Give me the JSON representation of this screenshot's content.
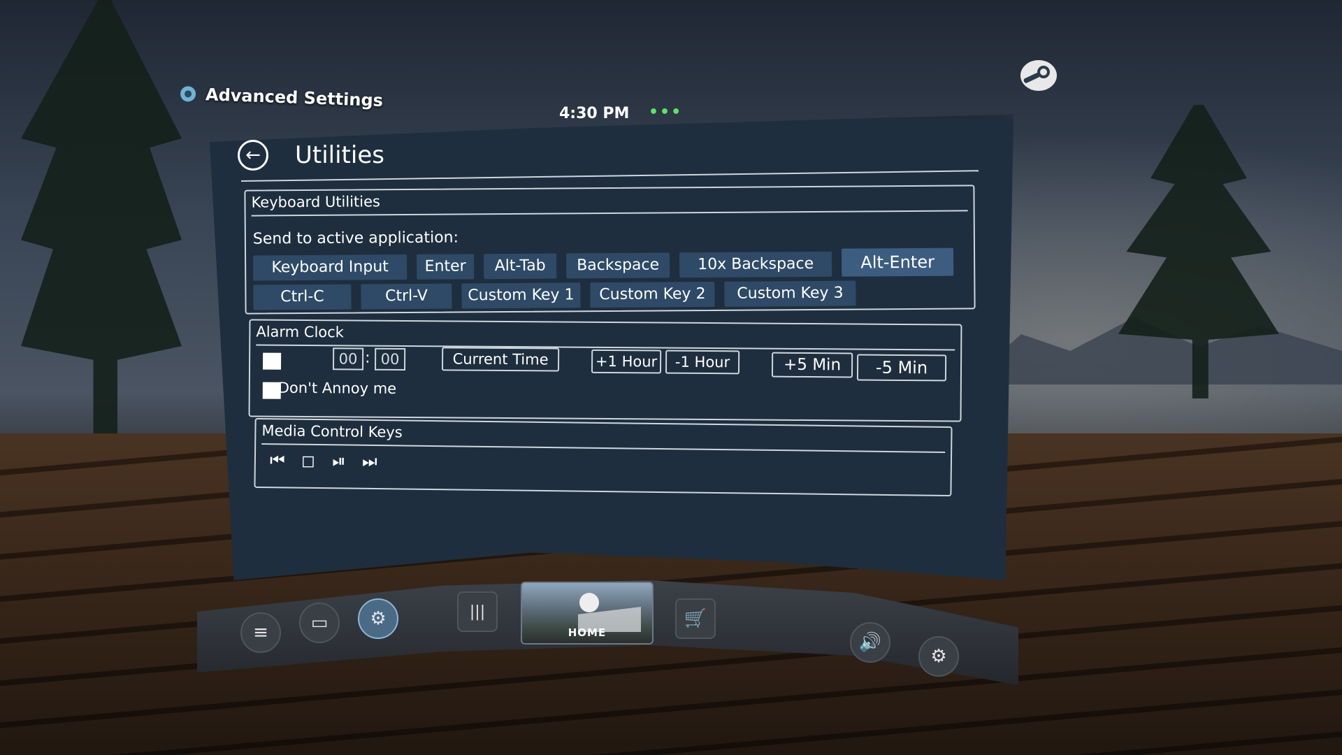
{
  "app": {
    "title": "Advanced Settings",
    "clock": "4:30 PM",
    "status_dots": "•••"
  },
  "page": {
    "title": "Utilities",
    "back_icon": "←"
  },
  "keyboard": {
    "title": "Keyboard Utilities",
    "send_label": "Send to active application:",
    "row1": [
      "Keyboard Input",
      "Enter",
      "Alt-Tab",
      "Backspace",
      "10x Backspace",
      "Alt-Enter"
    ],
    "row2": [
      "Ctrl-C",
      "Ctrl-V",
      "Custom Key 1",
      "Custom Key 2",
      "Custom Key 3"
    ]
  },
  "alarm": {
    "title": "Alarm Clock",
    "hour": "00",
    "minute": "00",
    "separator": ":",
    "current_time": "Current Time",
    "plus_hour": "+1 Hour",
    "minus_hour": "-1 Hour",
    "plus_min": "+5 Min",
    "minus_min": "-5 Min",
    "dont_annoy": "Don't Annoy me"
  },
  "media": {
    "title": "Media Control Keys",
    "prev": "⏮",
    "stop": "◻",
    "play_pause": "⏯",
    "next": "⏭"
  },
  "dock": {
    "menu": "≡",
    "window": "▭",
    "adv": "⚙",
    "library": "|||",
    "home_label": "HOME",
    "store": "🛒",
    "volume": "🔊",
    "settings": "⚙"
  }
}
